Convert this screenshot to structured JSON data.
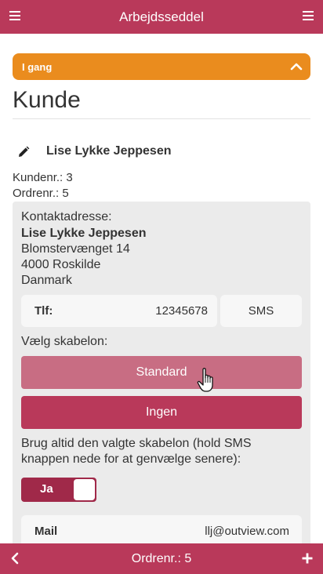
{
  "header": {
    "title": "Arbejdsseddel",
    "left_icon": "menu-icon",
    "right_icon": "menu-icon"
  },
  "status": {
    "label": "I gang",
    "icon": "chevron-up-icon",
    "color": "#ea8c1e"
  },
  "section_title": "Kunde",
  "customer": {
    "name": "Lise Lykke Jeppesen",
    "edit_icon": "pencil-icon",
    "kundenr": "Kundenr.: 3",
    "ordrenr": "Ordrenr.: 5"
  },
  "contact": {
    "label": "Kontaktadresse:",
    "name": "Lise Lykke Jeppesen",
    "street": "Blomstervænget 14",
    "city": "4000 Roskilde",
    "country": "Danmark"
  },
  "phone": {
    "label": "Tlf:",
    "number": "12345678",
    "sms_label": "SMS"
  },
  "template": {
    "label": "Vælg skabelon:",
    "options": [
      "Standard",
      "Ingen"
    ]
  },
  "always_use": {
    "text": "Brug altid den valgte skabelon (hold SMS knappen nede for at genvælge senere):",
    "toggle_label": "Ja",
    "toggle_on": true
  },
  "mail": {
    "label": "Mail",
    "value": "llj@outview.com"
  },
  "footer": {
    "title": "Ordrenr.: 5",
    "back_icon": "chevron-left-icon",
    "add_icon": "plus-icon"
  },
  "colors": {
    "brand": "#b9395a",
    "brand_light": "#c86d83",
    "toggle": "#a02949",
    "panel_bg": "#ebebeb"
  }
}
